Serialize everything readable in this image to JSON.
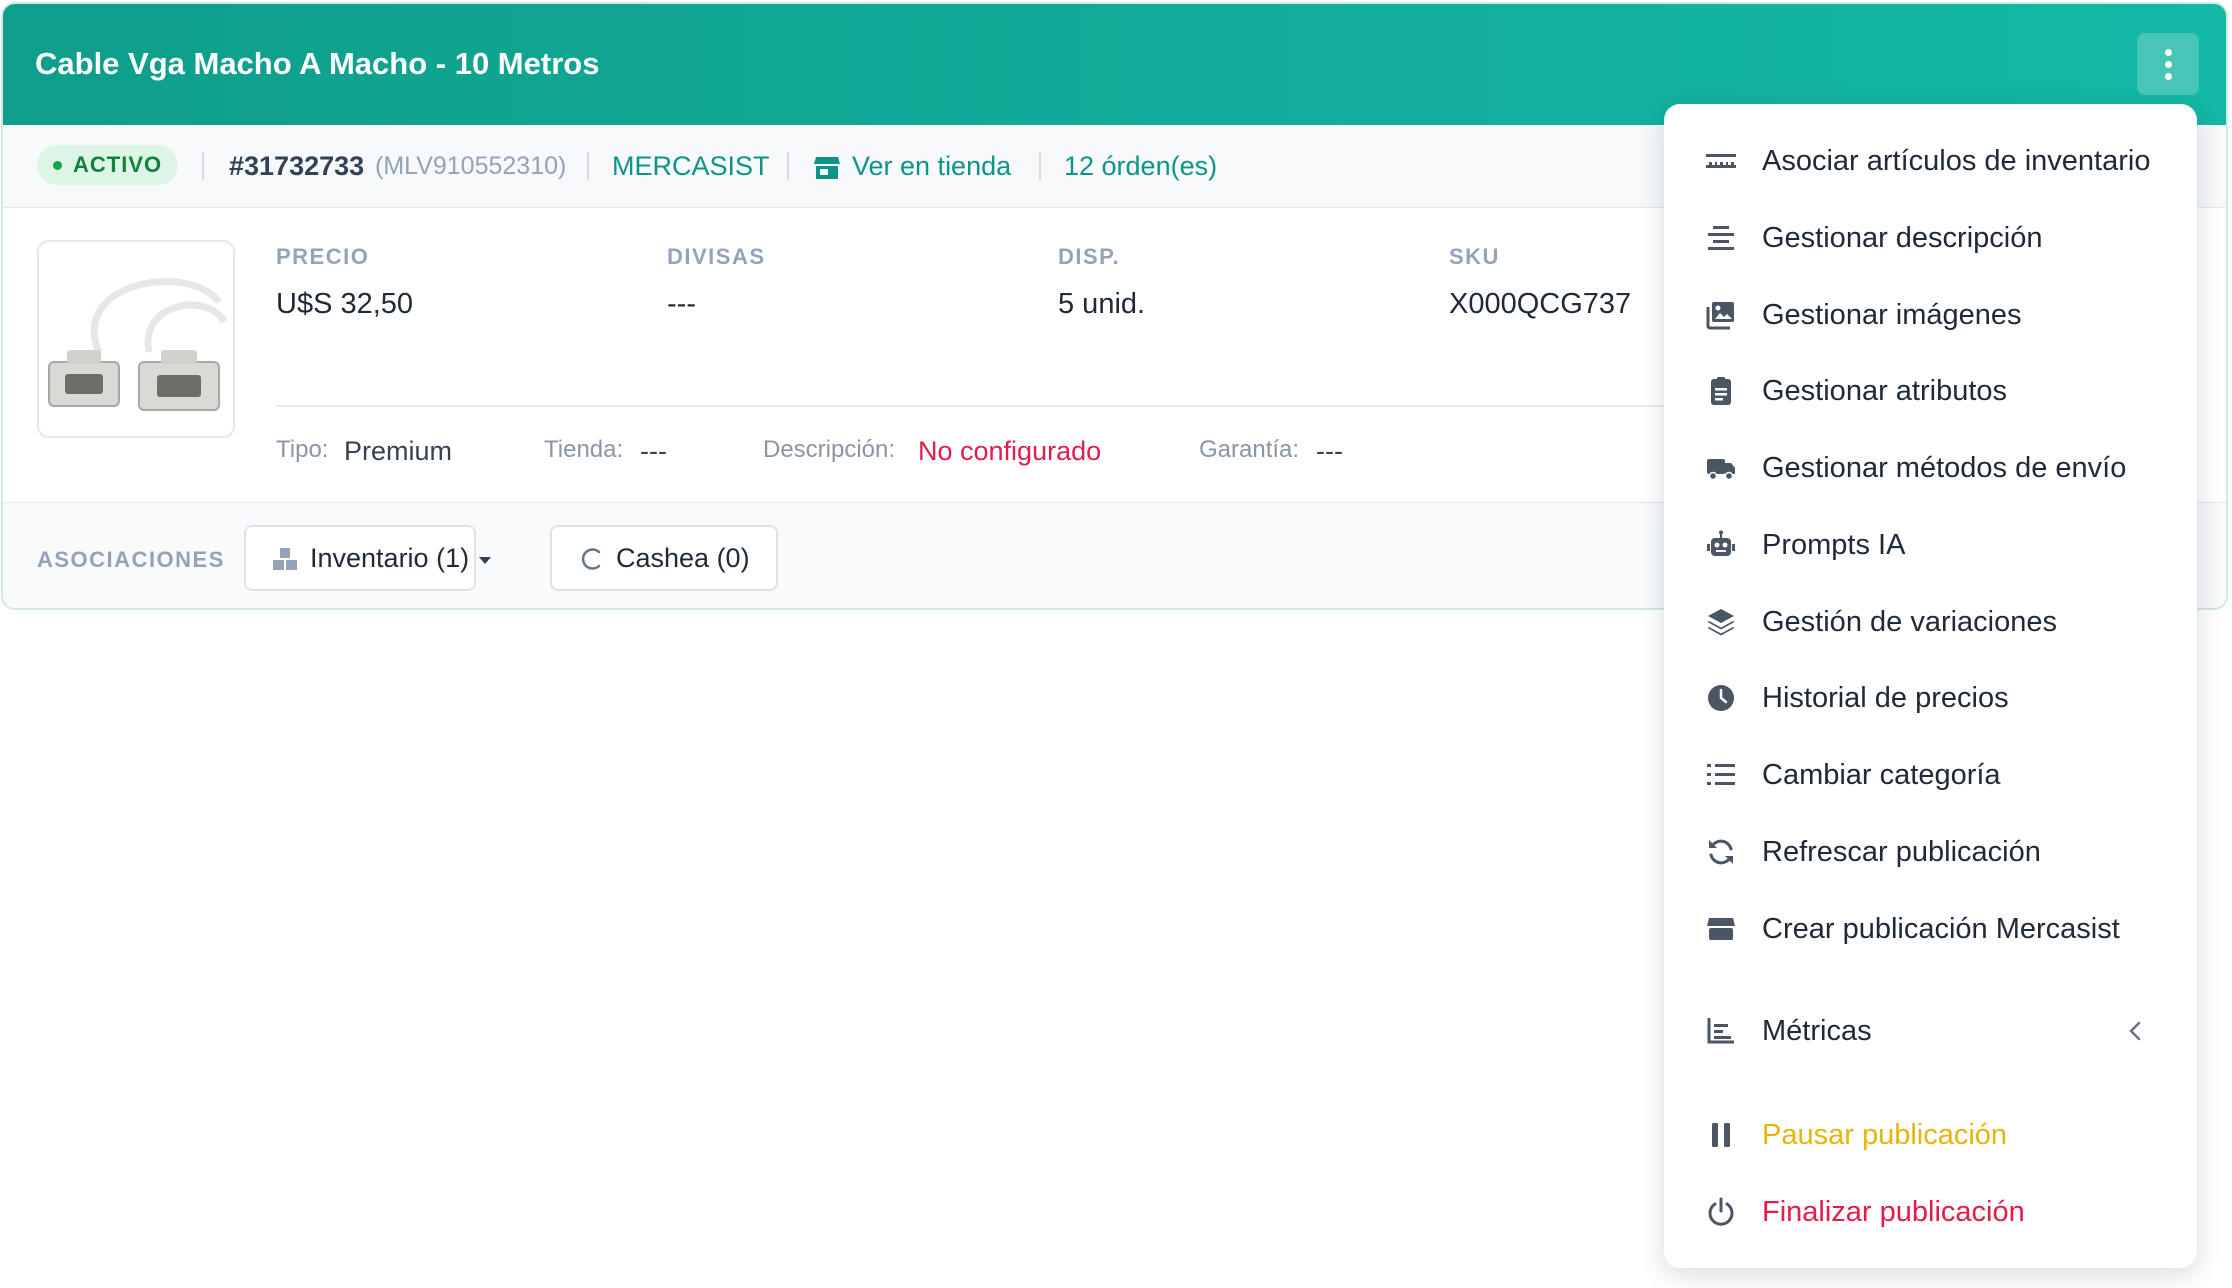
{
  "listing": {
    "title": "Cable Vga Macho A Macho - 10 Metros",
    "status": "ACTIVO",
    "id": "#31732733",
    "external_id": "(MLV910552310)",
    "store": "MERCASIST",
    "store_link": "Ver en tienda",
    "orders": "12 órden(es)"
  },
  "details": {
    "price_label": "PRECIO",
    "price_value": "U$S 32,50",
    "currency_label": "DIVISAS",
    "currency_value": "---",
    "stock_label": "DISP.",
    "stock_value": "5 unid.",
    "sku_label": "SKU",
    "sku_value": "X000QCG737",
    "type_label": "Tipo:",
    "type_value": "Premium",
    "shop_label": "Tienda:",
    "shop_value": "---",
    "description_label": "Descripción:",
    "description_value": "No configurado",
    "warranty_label": "Garantía:",
    "warranty_value": "---"
  },
  "associations": {
    "label": "ASOCIACIONES",
    "inventory_button": "Inventario (1)",
    "cashea_button": "Cashea (0)"
  },
  "menu": {
    "items": [
      {
        "label": "Asociar artículos de inventario",
        "icon": "barcode-icon"
      },
      {
        "label": "Gestionar descripción",
        "icon": "align-center-icon"
      },
      {
        "label": "Gestionar imágenes",
        "icon": "images-icon"
      },
      {
        "label": "Gestionar atributos",
        "icon": "clipboard-icon"
      },
      {
        "label": "Gestionar métodos de envío",
        "icon": "truck-icon"
      },
      {
        "label": "Prompts IA",
        "icon": "robot-icon"
      },
      {
        "label": "Gestión de variaciones",
        "icon": "layers-icon"
      },
      {
        "label": "Historial de precios",
        "icon": "clock-icon"
      },
      {
        "label": "Cambiar categoría",
        "icon": "list-icon"
      },
      {
        "label": "Refrescar publicación",
        "icon": "refresh-icon"
      },
      {
        "label": "Crear publicación Mercasist",
        "icon": "store-icon"
      },
      {
        "label": "Métricas",
        "icon": "bar-chart-icon"
      },
      {
        "label": "Pausar publicación",
        "icon": "pause-icon"
      },
      {
        "label": "Finalizar publicación",
        "icon": "power-icon"
      }
    ]
  },
  "colors": {
    "header_teal": "#14b8a6",
    "accent_teal": "#0d9488",
    "danger": "#e11d48",
    "warning": "#eab308",
    "active_green": "#16a34a"
  }
}
